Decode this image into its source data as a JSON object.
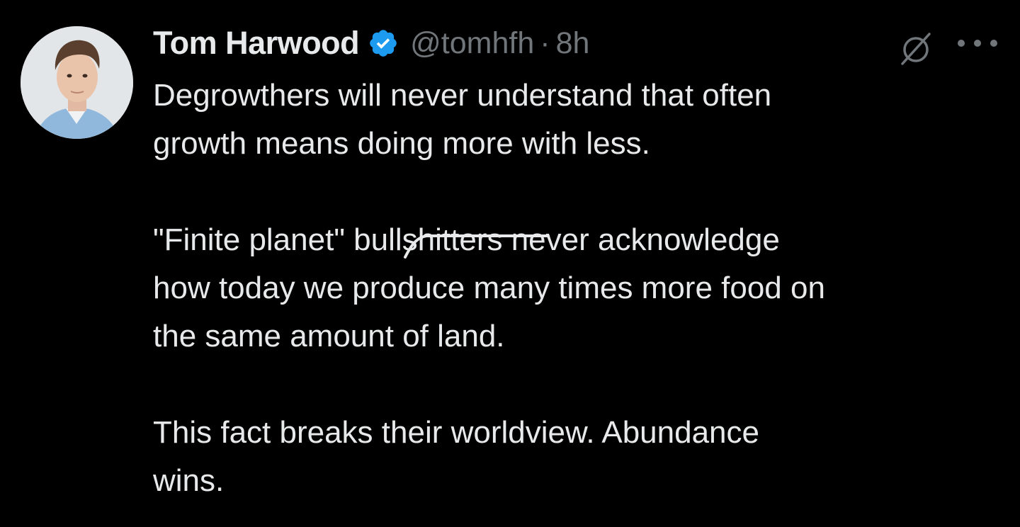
{
  "author": {
    "display_name": "Tom Harwood",
    "handle": "@tomhfh",
    "separator": "·",
    "time": "8h",
    "verified_icon": "verified-badge-icon",
    "verified_color": "#1d9bf0"
  },
  "tweet": {
    "para1": {
      "line1": "Degrowthers will never understand that often",
      "line2": "growth means doing more with less."
    },
    "para2": {
      "line1_before": "\"Finite planet\" bull",
      "line1_struck": "shitters",
      "line1_after": " never acknowledge",
      "line2": "how today we produce many times more food on",
      "line3": "the same amount of land."
    },
    "para3": {
      "line1": "This fact breaks their worldview. Abundance",
      "line2": "wins."
    }
  },
  "actions": {
    "grok_icon": "grok-slash-icon",
    "more_icon": "more-dots-icon"
  },
  "colors": {
    "background": "#000000",
    "text": "#e7e9ea",
    "muted": "#71767b"
  }
}
